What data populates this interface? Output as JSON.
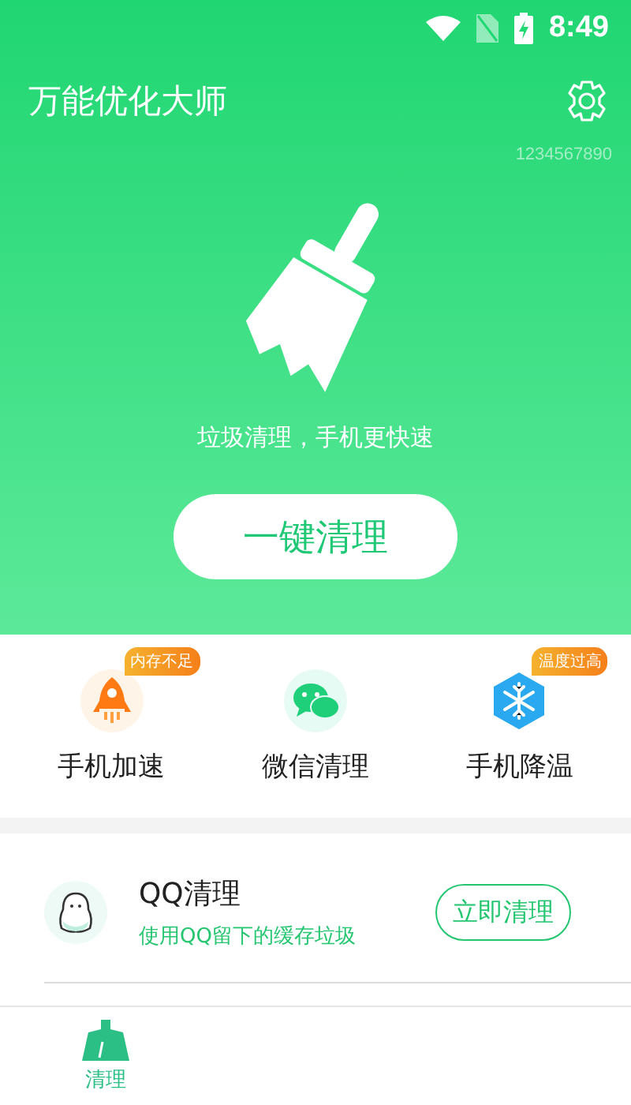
{
  "status_bar": {
    "time": "8:49"
  },
  "header": {
    "title": "万能优化大师",
    "code": "1234567890",
    "slogan": "垃圾清理，手机更快速",
    "button": "一键清理"
  },
  "features": [
    {
      "kind": "rocket",
      "label": "手机加速",
      "badge": "内存不足"
    },
    {
      "kind": "chat",
      "label": "微信清理"
    },
    {
      "kind": "snow",
      "label": "手机降温",
      "badge": "温度过高"
    }
  ],
  "list": [
    {
      "kind": "qq",
      "title": "QQ清理",
      "subtitle": "使用QQ留下的缓存垃圾",
      "action": "立即清理"
    }
  ],
  "nav": [
    {
      "label": "清理",
      "selected": true
    }
  ]
}
